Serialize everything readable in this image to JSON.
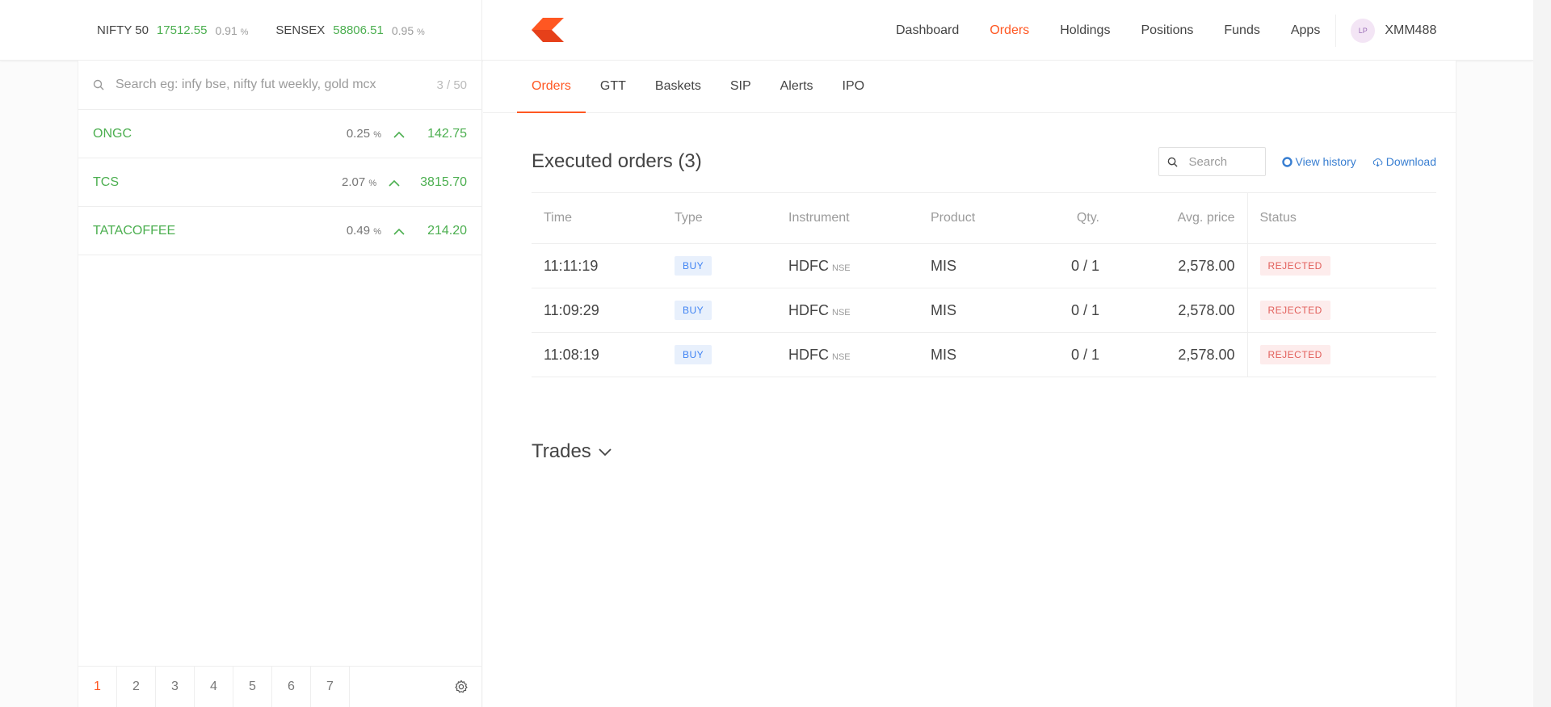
{
  "header": {
    "indices": [
      {
        "name": "NIFTY 50",
        "value": "17512.55",
        "change": "0.91",
        "unit": "%"
      },
      {
        "name": "SENSEX",
        "value": "58806.51",
        "change": "0.95",
        "unit": "%"
      }
    ],
    "nav": [
      "Dashboard",
      "Orders",
      "Holdings",
      "Positions",
      "Funds",
      "Apps"
    ],
    "active_nav": "Orders",
    "user": {
      "initials": "LP",
      "id": "XMM488"
    },
    "brand_color": "#ff5722"
  },
  "sidebar": {
    "search_placeholder": "Search eg: infy bse, nifty fut weekly, gold mcx",
    "count": "3 / 50",
    "watchlist": [
      {
        "name": "ONGC",
        "change": "0.25",
        "unit": "%",
        "price": "142.75",
        "direction": "up"
      },
      {
        "name": "TCS",
        "change": "2.07",
        "unit": "%",
        "price": "3815.70",
        "direction": "up"
      },
      {
        "name": "TATACOFFEE",
        "change": "0.49",
        "unit": "%",
        "price": "214.20",
        "direction": "up"
      }
    ],
    "pages": [
      "1",
      "2",
      "3",
      "4",
      "5",
      "6",
      "7"
    ],
    "active_page": "1"
  },
  "main": {
    "tabs": [
      "Orders",
      "GTT",
      "Baskets",
      "SIP",
      "Alerts",
      "IPO"
    ],
    "active_tab": "Orders",
    "title": "Executed orders (3)",
    "search_placeholder": "Search",
    "view_history": "View history",
    "download": "Download",
    "columns": [
      "Time",
      "Type",
      "Instrument",
      "Product",
      "Qty.",
      "Avg. price",
      "Status"
    ],
    "orders": [
      {
        "time": "11:11:19",
        "type": "BUY",
        "instrument": "HDFC",
        "exchange": "NSE",
        "product": "MIS",
        "qty": "0 / 1",
        "avg_price": "2,578.00",
        "status": "REJECTED"
      },
      {
        "time": "11:09:29",
        "type": "BUY",
        "instrument": "HDFC",
        "exchange": "NSE",
        "product": "MIS",
        "qty": "0 / 1",
        "avg_price": "2,578.00",
        "status": "REJECTED"
      },
      {
        "time": "11:08:19",
        "type": "BUY",
        "instrument": "HDFC",
        "exchange": "NSE",
        "product": "MIS",
        "qty": "0 / 1",
        "avg_price": "2,578.00",
        "status": "REJECTED"
      }
    ],
    "trades_label": "Trades"
  }
}
